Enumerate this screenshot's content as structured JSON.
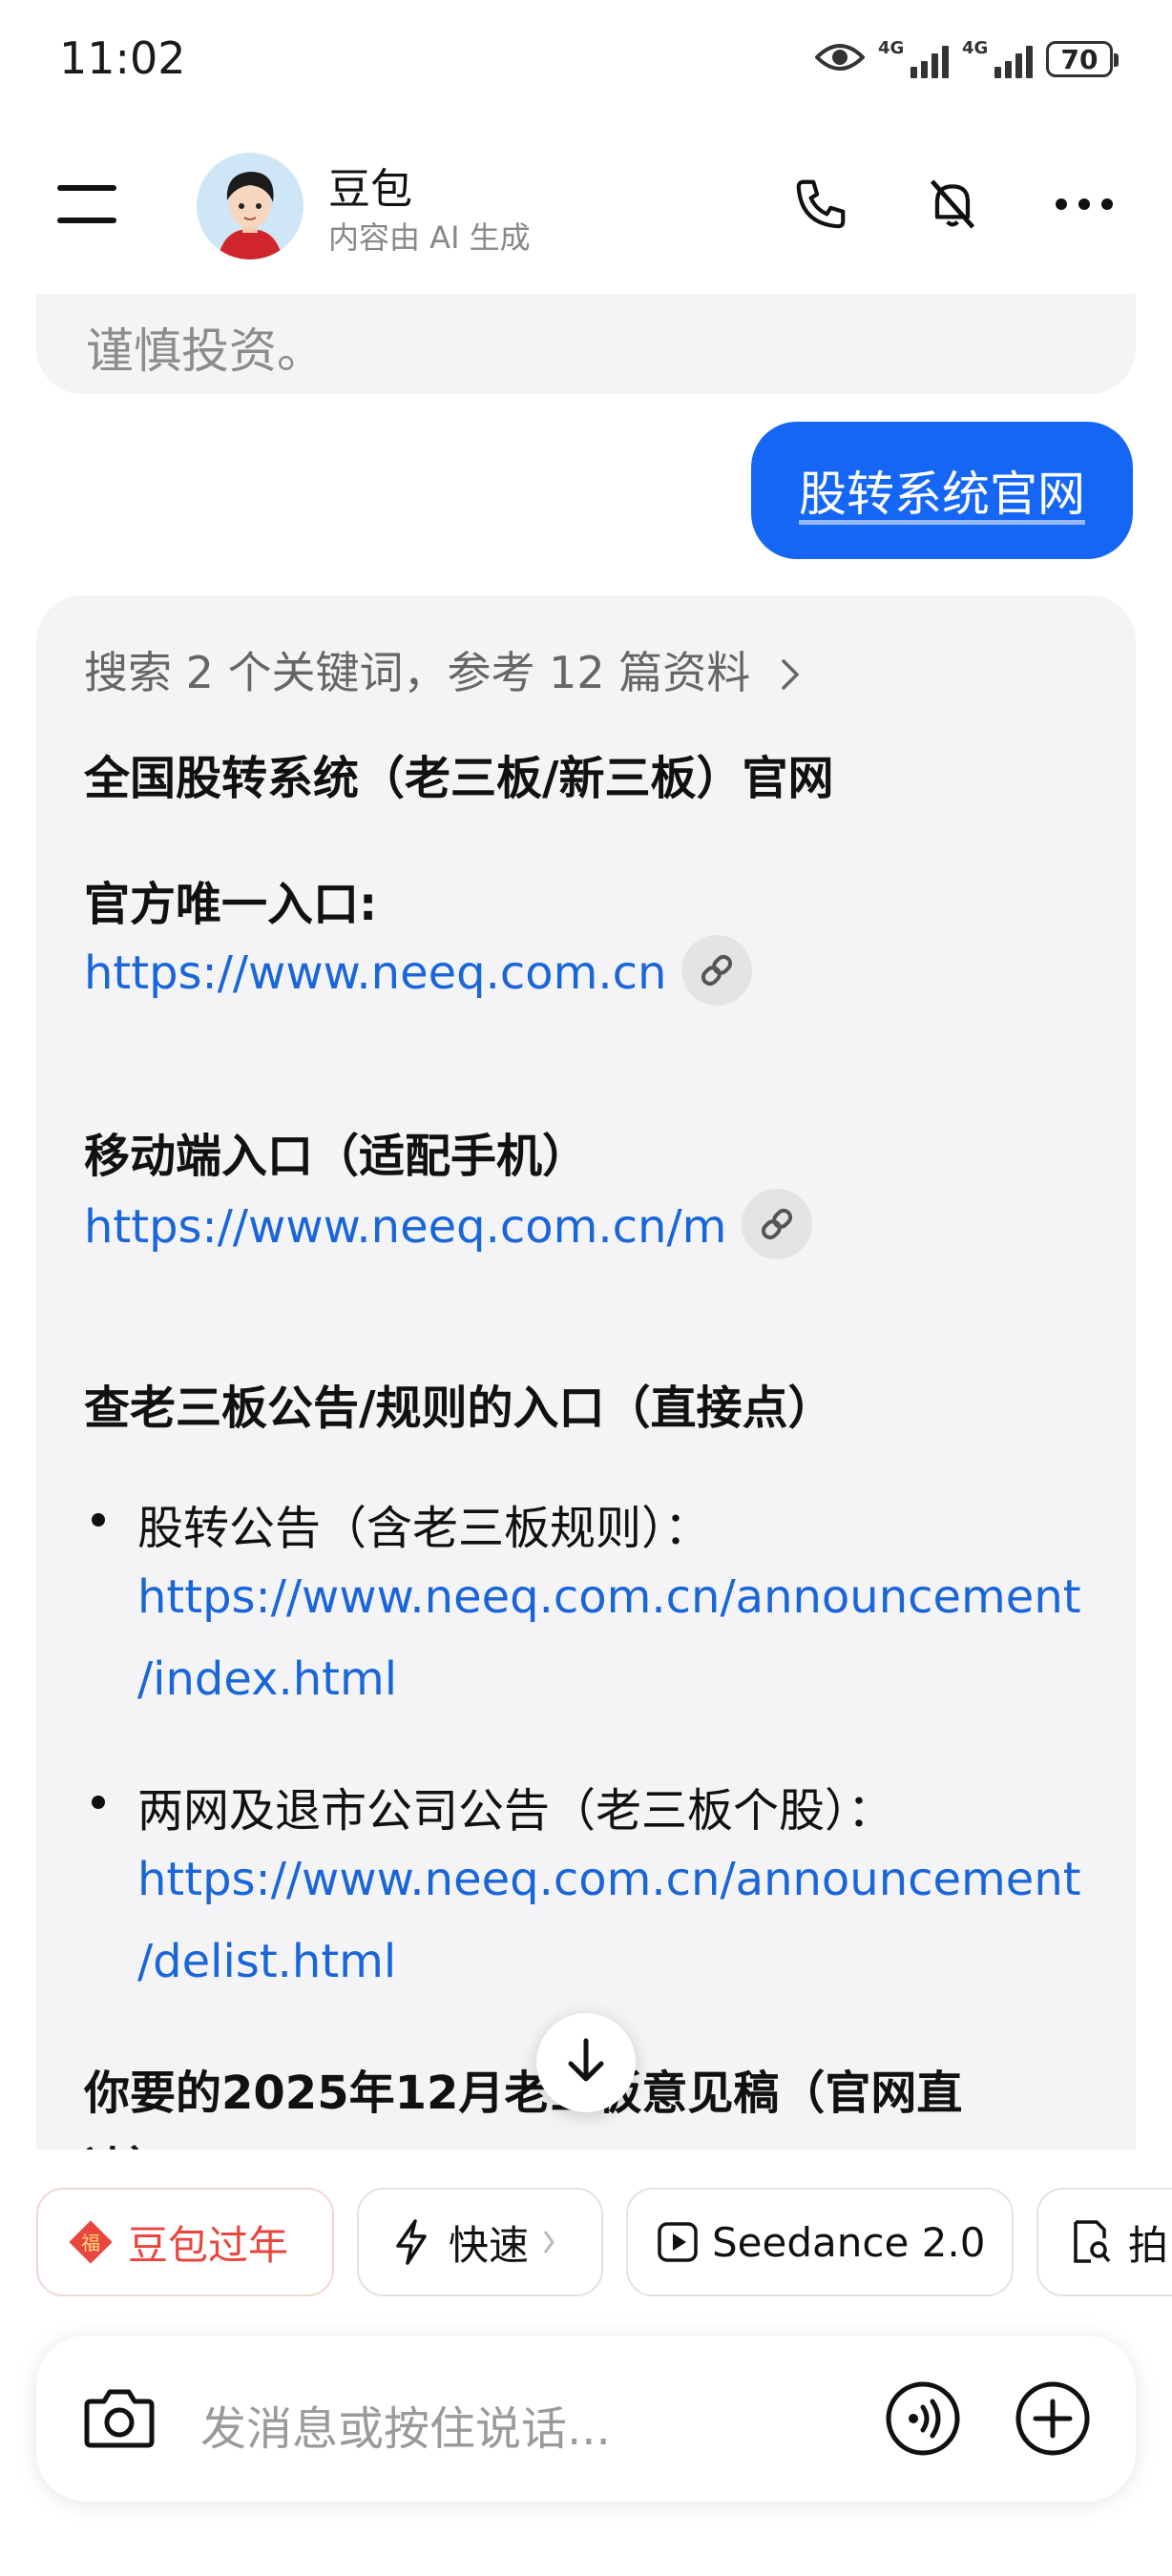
{
  "status_bar": {
    "time": "11:02",
    "network_tag_1": "4G",
    "network_tag_2": "4G",
    "battery": "70",
    "icons": [
      "eye-icon",
      "signal-icon",
      "signal-icon",
      "battery-icon"
    ]
  },
  "header": {
    "bot_name": "豆包",
    "bot_subtitle": "内容由 AI 生成",
    "icons": [
      "menu-icon",
      "phone-icon",
      "mute-icon",
      "more-icon"
    ]
  },
  "chat": {
    "prev_tail": "谨慎投资。",
    "user_message": "股转系统官网",
    "search_summary": "搜索 2 个关键词，参考 12 篇资料",
    "title": "全国股转系统（老三板/新三板）官网",
    "official_label": "官方唯一入口:",
    "official_url": "https://www.neeq.com.cn",
    "mobile_label": "移动端入口（适配手机）",
    "mobile_url": "https://www.neeq.com.cn/m",
    "rules_heading": "查老三板公告/规则的入口（直接点）",
    "bullets": [
      {
        "text": "股转公告（含老三板规则）：",
        "url_line1": "https://www.neeq.com.cn/announcement",
        "url_line2": "/index.html"
      },
      {
        "text": "两网及退市公司公告（老三板个股）：",
        "url_line1": "https://www.neeq.com.cn/announcement",
        "url_line2": "/delist.html"
      }
    ],
    "bottom_heading_line1": "你要的2025年12月老三板意见稿（官网直",
    "bottom_heading_line2": "达）"
  },
  "chips": [
    {
      "label": "豆包过年",
      "icon": "fu-icon"
    },
    {
      "label": "快速",
      "icon": "lightning-icon"
    },
    {
      "label": "Seedance 2.0",
      "icon": "play-icon"
    },
    {
      "label": "拍",
      "icon": "doc-search-icon"
    }
  ],
  "composer": {
    "placeholder": "发消息或按住说话..."
  },
  "colors": {
    "accent": "#1666f5",
    "link": "#1a66d9",
    "chip_red": "#e8463e",
    "bubble_bg": "#f4f4f6"
  }
}
